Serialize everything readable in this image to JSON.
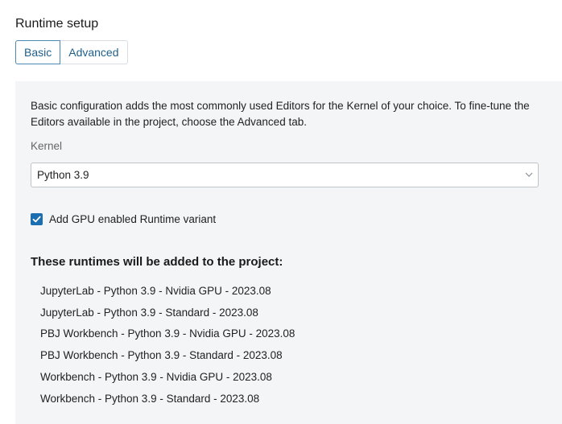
{
  "page_title": "Runtime setup",
  "tabs": [
    {
      "label": "Basic",
      "active": true
    },
    {
      "label": "Advanced",
      "active": false
    }
  ],
  "basic": {
    "description": "Basic configuration adds the most commonly used Editors for the Kernel of your choice. To fine-tune the Editors available in the project, choose the Advanced tab.",
    "kernel_label": "Kernel",
    "kernel_value": "Python 3.9",
    "gpu_checkbox_label": "Add GPU enabled Runtime variant",
    "gpu_checked": true,
    "runtimes_heading": "These runtimes will be added to the project:",
    "runtimes": [
      "JupyterLab - Python 3.9 - Nvidia GPU - 2023.08",
      "JupyterLab - Python 3.9 - Standard - 2023.08",
      "PBJ Workbench - Python 3.9 - Nvidia GPU - 2023.08",
      "PBJ Workbench - Python 3.9 - Standard - 2023.08",
      "Workbench - Python 3.9 - Nvidia GPU - 2023.08",
      "Workbench - Python 3.9 - Standard - 2023.08"
    ]
  },
  "colors": {
    "accent": "#1b6fb0",
    "tab_text": "#1f5f8b",
    "panel_bg": "#f4f5f7"
  },
  "icons": {
    "select": "chevron-down-icon",
    "checkbox": "checkmark-icon"
  }
}
